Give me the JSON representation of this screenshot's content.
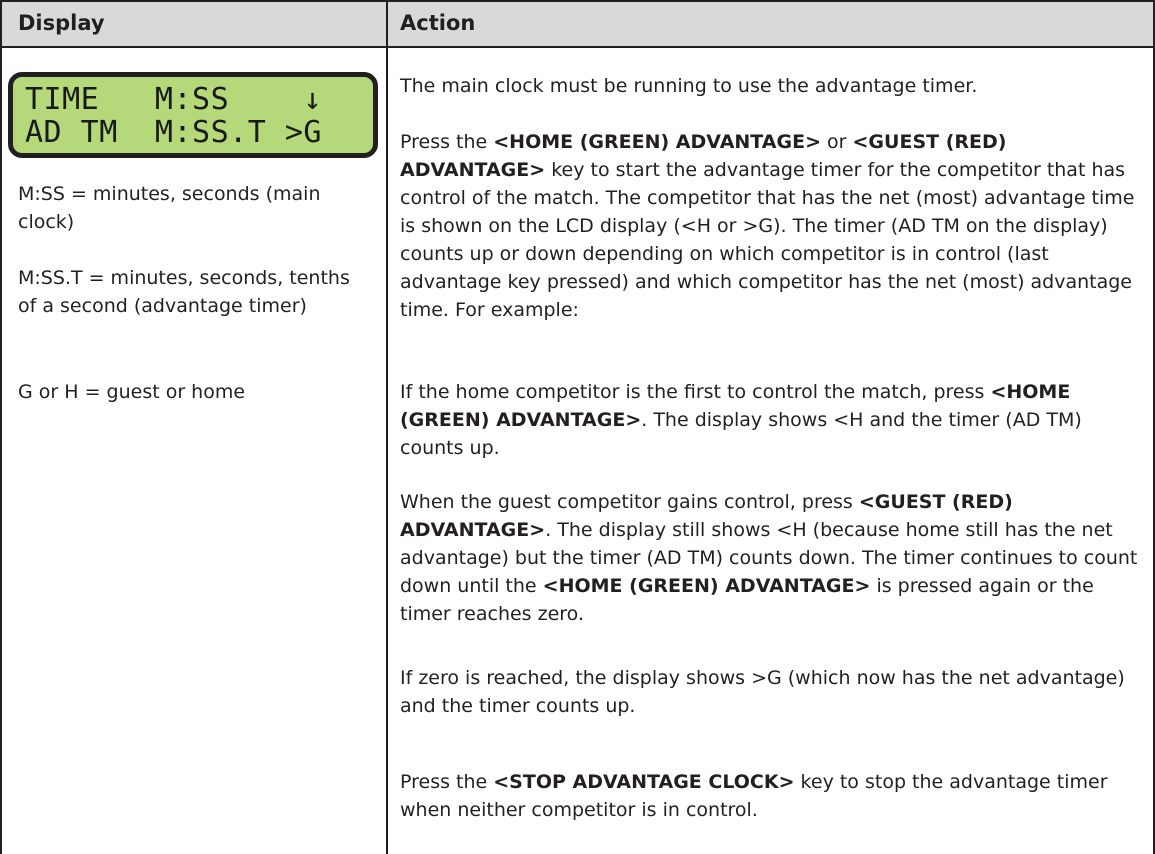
{
  "header": {
    "col_display": "Display",
    "col_action": "Action"
  },
  "lcd": {
    "line1": "TIME   M:SS    ↓",
    "line2": "AD TM  M:SS.T >G",
    "background": "#b4d87a"
  },
  "legend": {
    "item1": "M:SS = minutes, seconds (main clock)",
    "item2": "M:SS.T = minutes, seconds, tenths of a second (advantage timer)",
    "item3": "G or H = guest or home"
  },
  "action": {
    "p1": "The main clock must be running to use the advantage timer.",
    "p2": {
      "t1": "Press the ",
      "k1": "<HOME (GREEN) ADVANTAGE>",
      "t2": " or ",
      "k2": "<GUEST (RED) ADVANTAGE>",
      "t3": " key to start the advantage timer for the competitor that has control of the match. The competitor that has the net (most) advantage time is shown on the LCD display (<H or >G). The timer (AD TM on the display) counts up or down depending on which competitor is in control (last advantage key pressed) and which competitor has the net (most) advantage time. For example:"
    },
    "p3": {
      "t1": "If the home competitor is the first to control the match, press ",
      "k1": "<HOME (GREEN) ADVANTAGE>",
      "t2": ". The display shows <H and the timer (AD TM) counts up."
    },
    "p4": {
      "t1": "When the guest competitor gains control, press ",
      "k1": "<GUEST (RED) ADVANTAGE>",
      "t2": ". The display still shows <H (because home still has the net advantage) but the timer (AD TM) counts down. The timer continues to count down until the ",
      "k2": "<HOME (GREEN) ADVANTAGE>",
      "t3": " is pressed again or the timer reaches zero."
    },
    "p5": "If zero is reached, the display shows >G (which now has the net advantage) and the timer counts up.",
    "p6": {
      "t1": "Press the ",
      "k1": "<STOP ADVANTAGE CLOCK>",
      "t2": " key to stop the advantage timer when neither competitor is in control."
    }
  }
}
